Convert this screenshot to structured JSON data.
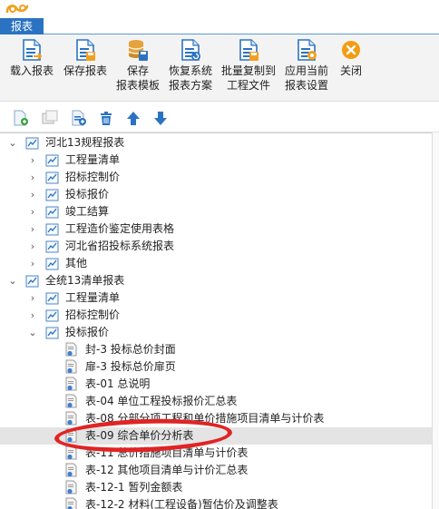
{
  "app": {
    "tab_label": "报表"
  },
  "ribbon": [
    {
      "name": "load-report-button",
      "line1": "载入报表",
      "line2": "",
      "icon": "load-report-icon",
      "color": "#2b73c2"
    },
    {
      "name": "save-report-button",
      "line1": "保存报表",
      "line2": "",
      "icon": "save-report-icon",
      "color": "#2b73c2"
    },
    {
      "name": "save-template-button",
      "line1": "保存",
      "line2": "报表模板",
      "icon": "database-save-icon",
      "color": "#e6a23c"
    },
    {
      "name": "restore-scheme-button",
      "line1": "恢复系统",
      "line2": "报表方案",
      "icon": "restore-scheme-icon",
      "color": "#2b73c2"
    },
    {
      "name": "batch-copy-button",
      "line1": "批量复制到",
      "line2": "工程文件",
      "icon": "batch-copy-icon",
      "color": "#2b73c2"
    },
    {
      "name": "apply-settings-button",
      "line1": "应用当前",
      "line2": "报表设置",
      "icon": "apply-settings-icon",
      "color": "#2b73c2"
    },
    {
      "name": "close-button",
      "line1": "关闭",
      "line2": "",
      "icon": "close-icon",
      "color": "#f39c12"
    }
  ],
  "toolbar": [
    {
      "name": "add-report-icon"
    },
    {
      "name": "copy-folder-icon"
    },
    {
      "name": "new-report-icon"
    },
    {
      "name": "delete-icon"
    },
    {
      "name": "move-up-icon"
    },
    {
      "name": "move-down-icon"
    }
  ],
  "tree": [
    {
      "level": 0,
      "type": "folder",
      "expanded": true,
      "label": "河北13规程报表"
    },
    {
      "level": 1,
      "type": "folder",
      "expanded": false,
      "label": "工程量清单"
    },
    {
      "level": 1,
      "type": "folder",
      "expanded": false,
      "label": "招标控制价"
    },
    {
      "level": 1,
      "type": "folder",
      "expanded": false,
      "label": "投标报价"
    },
    {
      "level": 1,
      "type": "folder",
      "expanded": false,
      "label": "竣工结算"
    },
    {
      "level": 1,
      "type": "folder",
      "expanded": false,
      "label": "工程造价鉴定使用表格"
    },
    {
      "level": 1,
      "type": "folder",
      "expanded": false,
      "label": "河北省招投标系统报表"
    },
    {
      "level": 1,
      "type": "folder",
      "expanded": false,
      "label": "其他"
    },
    {
      "level": 0,
      "type": "folder",
      "expanded": true,
      "label": "全统13清单报表"
    },
    {
      "level": 1,
      "type": "folder",
      "expanded": false,
      "label": "工程量清单"
    },
    {
      "level": 1,
      "type": "folder",
      "expanded": false,
      "label": "招标控制价"
    },
    {
      "level": 1,
      "type": "folder",
      "expanded": true,
      "label": "投标报价"
    },
    {
      "level": 2,
      "type": "doc",
      "label": "封-3 投标总价封面"
    },
    {
      "level": 2,
      "type": "doc",
      "label": "扉-3 投标总价扉页"
    },
    {
      "level": 2,
      "type": "doc",
      "label": "表-01 总说明"
    },
    {
      "level": 2,
      "type": "doc",
      "label": "表-04 单位工程投标报价汇总表"
    },
    {
      "level": 2,
      "type": "doc",
      "label": "表-08 分部分项工程和单价措施项目清单与计价表"
    },
    {
      "level": 2,
      "type": "doc",
      "label": "表-09 综合单价分析表",
      "selected": true
    },
    {
      "level": 2,
      "type": "doc",
      "label": "表-11 总价措施项目清单与计价表"
    },
    {
      "level": 2,
      "type": "doc",
      "label": "表-12 其他项目清单与计价汇总表"
    },
    {
      "level": 2,
      "type": "doc",
      "label": "表-12-1 暂列金额表"
    },
    {
      "level": 2,
      "type": "doc",
      "label": "表-12-2 材料(工程设备)暂估价及调整表"
    }
  ],
  "colors": {
    "accent": "#2b73c2",
    "highlight_ring": "#e02424",
    "selected_row": "#e4e4e4"
  }
}
